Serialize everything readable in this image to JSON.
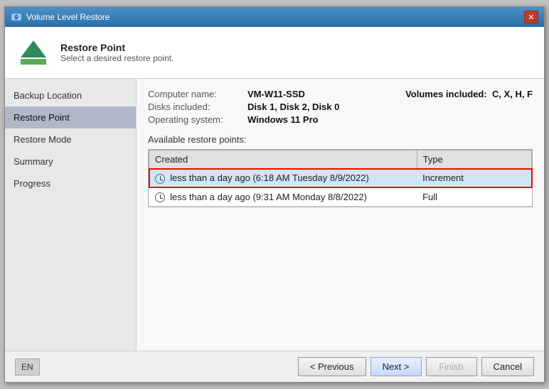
{
  "window": {
    "title": "Volume Level Restore",
    "close_label": "✕"
  },
  "header": {
    "step_title": "Restore Point",
    "step_subtitle": "Select a desired restore point."
  },
  "sidebar": {
    "items": [
      {
        "id": "backup-location",
        "label": "Backup Location"
      },
      {
        "id": "restore-point",
        "label": "Restore Point",
        "active": true
      },
      {
        "id": "restore-mode",
        "label": "Restore Mode"
      },
      {
        "id": "summary",
        "label": "Summary"
      },
      {
        "id": "progress",
        "label": "Progress"
      }
    ]
  },
  "content": {
    "computer_name_label": "Computer name:",
    "computer_name_value": "VM-W11-SSD",
    "disks_label": "Disks included:",
    "disks_value": "Disk 1, Disk 2, Disk 0",
    "os_label": "Operating system:",
    "os_value": "Windows 11 Pro",
    "volumes_label": "Volumes included:",
    "volumes_value": "C, X, H, F",
    "available_label": "Available restore points:",
    "table_headers": [
      "Created",
      "Type"
    ],
    "restore_points": [
      {
        "created": "less than a day ago (6:18 AM Tuesday 8/9/2022)",
        "type": "Increment",
        "selected": true
      },
      {
        "created": "less than a day ago (9:31 AM Monday 8/8/2022)",
        "type": "Full",
        "selected": false
      }
    ]
  },
  "footer": {
    "locale": "EN",
    "btn_previous": "< Previous",
    "btn_next": "Next >",
    "btn_finish": "Finish",
    "btn_cancel": "Cancel"
  }
}
